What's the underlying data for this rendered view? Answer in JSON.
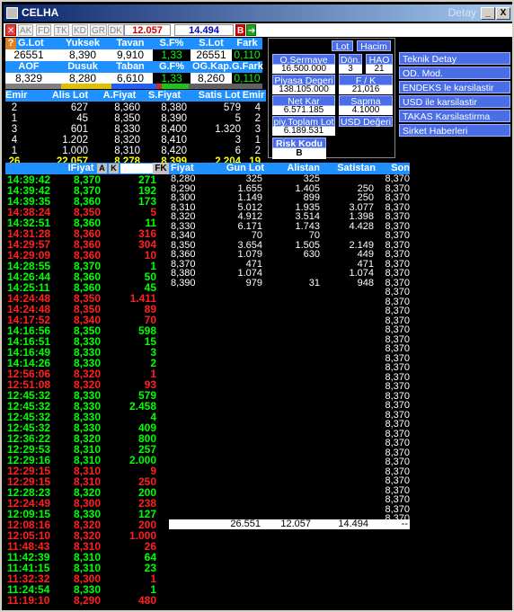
{
  "window": {
    "title": "CELHA",
    "subtitle": "Detay",
    "min_label": "_",
    "max_label": "□",
    "close_label": "X"
  },
  "toolbar": {
    "buttons": [
      "AK",
      "FD",
      "TK",
      "KD",
      "GR",
      "DK"
    ],
    "bid_value": "12.057",
    "ask_value": "14.494",
    "b_label": "B"
  },
  "summary1": {
    "headers": [
      "G.Lot",
      "Yuksek",
      "Tavan",
      "S.F%",
      "S.Lot",
      "Fark"
    ],
    "values": [
      "26551",
      "8,390",
      "9,910",
      "1,33",
      "26551",
      "0,110"
    ]
  },
  "summary2": {
    "headers": [
      "AOF",
      "Dusuk",
      "Taban",
      "G.F%",
      "OG.Kap.",
      "G.Fark"
    ],
    "values": [
      "8,329",
      "8,280",
      "6,610",
      "1,33",
      "8,260",
      "0,110"
    ]
  },
  "depth": {
    "headers": [
      "Emir",
      "Alis Lot",
      "A.Fiyat",
      "S.Fiyat",
      "Satis Lot",
      "Emir"
    ],
    "rows": [
      [
        "2",
        "627",
        "8,360",
        "8,380",
        "579",
        "4"
      ],
      [
        "1",
        "45",
        "8,350",
        "8,390",
        "5",
        "2"
      ],
      [
        "3",
        "601",
        "8,330",
        "8,400",
        "1.320",
        "3"
      ],
      [
        "4",
        "1.202",
        "8,320",
        "8,410",
        "3",
        "1"
      ],
      [
        "1",
        "1.000",
        "8,310",
        "8,420",
        "6",
        "2"
      ]
    ],
    "total": [
      "26",
      "22.057",
      "8,278",
      "8,399",
      "2.204",
      "19"
    ]
  },
  "panel": {
    "lot_label": "Lot",
    "hacim_label": "Hacim",
    "osermaye_label": "O.Sermaye",
    "osermaye_value": "16.500.000",
    "don_label": "Dön.",
    "don_value": "3",
    "hao_label": "HAO",
    "hao_value": "21",
    "piyasa_label": "Piyasa Degeri",
    "piyasa_value": "138.105.000",
    "fk_label": "F / K",
    "fk_value": "21,016",
    "netkar_label": "Net Kar",
    "netkar_value": "6.571.185",
    "sapma_label": "Sapma",
    "sapma_value": "4.1000",
    "piytop_label": "piy.Toplam Lot",
    "piytop_value": "6.189.531",
    "usd_label": "USD Değeri",
    "risk_label": "Risk Kodu",
    "risk_value": "B"
  },
  "menu": [
    "Teknik Detay",
    "OD. Mod.",
    "ENDEKS le karsilastir",
    "USD ile karsilastir",
    "TAKAS Karsilastirma",
    "Sirket Haberleri"
  ],
  "trades": {
    "headers": [
      "IFiyat",
      "A",
      "K",
      "FK"
    ],
    "rows": [
      [
        "14:39:42",
        "8,370",
        "271",
        "g"
      ],
      [
        "14:39:42",
        "8,370",
        "192",
        "g"
      ],
      [
        "14:39:35",
        "8,360",
        "173",
        "g"
      ],
      [
        "14:38:24",
        "8,350",
        "5",
        "r"
      ],
      [
        "14:32:51",
        "8,360",
        "11",
        "g"
      ],
      [
        "14:31:28",
        "8,360",
        "316",
        "r"
      ],
      [
        "14:29:57",
        "8,360",
        "304",
        "r"
      ],
      [
        "14:29:09",
        "8,360",
        "10",
        "r"
      ],
      [
        "14:28:55",
        "8,370",
        "1",
        "g"
      ],
      [
        "14:26:44",
        "8,360",
        "50",
        "g"
      ],
      [
        "14:25:11",
        "8,360",
        "45",
        "g"
      ],
      [
        "14:24:48",
        "8,350",
        "1.411",
        "r"
      ],
      [
        "14:24:48",
        "8,350",
        "89",
        "r"
      ],
      [
        "14:17:52",
        "8,340",
        "70",
        "r"
      ],
      [
        "14:16:56",
        "8,350",
        "598",
        "g"
      ],
      [
        "14:16:51",
        "8,330",
        "15",
        "g"
      ],
      [
        "14:16:49",
        "8,330",
        "3",
        "g"
      ],
      [
        "14:14:26",
        "8,330",
        "2",
        "g"
      ],
      [
        "12:56:06",
        "8,320",
        "1",
        "r"
      ],
      [
        "12:51:08",
        "8,320",
        "93",
        "r"
      ],
      [
        "12:45:32",
        "8,330",
        "579",
        "g"
      ],
      [
        "12:45:32",
        "8,330",
        "2.458",
        "g"
      ],
      [
        "12:45:32",
        "8,330",
        "4",
        "g"
      ],
      [
        "12:45:32",
        "8,330",
        "409",
        "g"
      ],
      [
        "12:36:22",
        "8,320",
        "800",
        "g"
      ],
      [
        "12:29:53",
        "8,310",
        "257",
        "g"
      ],
      [
        "12:29:16",
        "8,310",
        "2.000",
        "g"
      ],
      [
        "12:29:15",
        "8,310",
        "9",
        "r"
      ],
      [
        "12:29:15",
        "8,310",
        "250",
        "r"
      ],
      [
        "12:28:23",
        "8,320",
        "200",
        "g"
      ],
      [
        "12:24:49",
        "8,300",
        "238",
        "r"
      ],
      [
        "12:09:15",
        "8,330",
        "127",
        "g"
      ],
      [
        "12:08:16",
        "8,320",
        "200",
        "r"
      ],
      [
        "12:05:10",
        "8,320",
        "1.000",
        "r"
      ],
      [
        "11:48:43",
        "8,310",
        "26",
        "r"
      ],
      [
        "11:42:39",
        "8,310",
        "64",
        "g"
      ],
      [
        "11:41:15",
        "8,310",
        "23",
        "g"
      ],
      [
        "11:32:32",
        "8,300",
        "1",
        "r"
      ],
      [
        "11:24:54",
        "8,330",
        "1",
        "g"
      ],
      [
        "11:19:10",
        "8,290",
        "480",
        "r"
      ]
    ]
  },
  "prices": {
    "headers": [
      "Fiyat",
      "Gun Lot",
      "Alistan",
      "Satistan",
      "Son"
    ],
    "rows": [
      [
        "8,280",
        "325",
        "325",
        "",
        "8,370"
      ],
      [
        "8,290",
        "1.655",
        "1.405",
        "250",
        "8,370"
      ],
      [
        "8,300",
        "1.149",
        "899",
        "250",
        "8,370"
      ],
      [
        "8,310",
        "5.012",
        "1.935",
        "3.077",
        "8,370"
      ],
      [
        "8,320",
        "4.912",
        "3.514",
        "1.398",
        "8,370"
      ],
      [
        "8,330",
        "6.171",
        "1.743",
        "4.428",
        "8,370"
      ],
      [
        "8,340",
        "70",
        "70",
        "",
        "8,370"
      ],
      [
        "8,350",
        "3.654",
        "1.505",
        "2.149",
        "8,370"
      ],
      [
        "8,360",
        "1.079",
        "630",
        "449",
        "8,370"
      ],
      [
        "8,370",
        "471",
        "",
        "471",
        "8,370"
      ],
      [
        "8,380",
        "1.074",
        "",
        "1.074",
        "8,370"
      ],
      [
        "8,390",
        "979",
        "31",
        "948",
        "8,370"
      ]
    ],
    "son_extra": "8,370",
    "totals": [
      "26.551",
      "12.057",
      "14.494",
      "--"
    ]
  },
  "colors": {
    "green": "#00ff00",
    "red": "#ff2020",
    "accent": "#1e90ff",
    "menu": "#4a6ee8"
  }
}
